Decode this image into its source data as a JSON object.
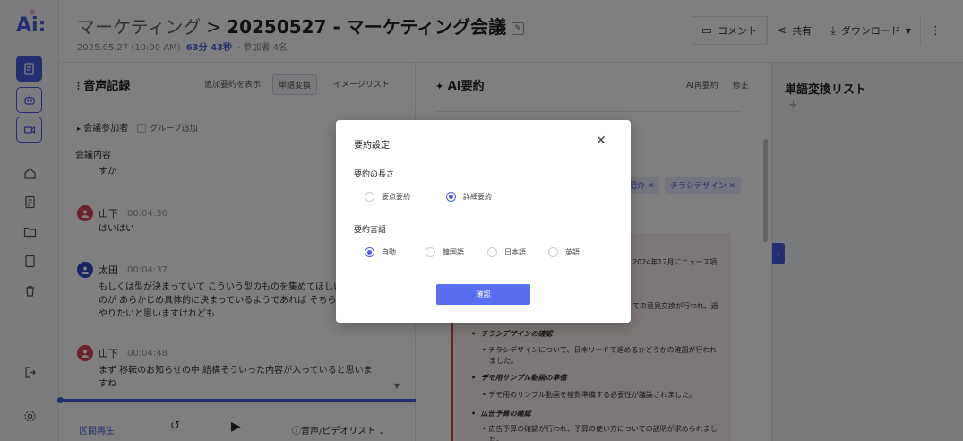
{
  "app": {
    "logo": "Ai:"
  },
  "header": {
    "parent": "マーケティング",
    "separator": ">",
    "title": "20250527 - マーケティング会議",
    "date": "2025.05.27 (10:00 AM)",
    "duration": "63分 43秒",
    "participants": "· 参加者 4名",
    "actions": {
      "comment": "コメント",
      "share": "共有",
      "download": "ダウンロード"
    }
  },
  "transcript": {
    "title": "音声記録",
    "tabs": [
      "追加要約を表示",
      "単語変換",
      "イメージリスト"
    ],
    "participants_label": "会議参加者",
    "group_add": "グループ追加",
    "content_label": "会議内容",
    "content_first": "すか",
    "entries": [
      {
        "speaker": "山下",
        "initial": "",
        "time": "00:04:36",
        "lines": [
          "はいはい"
        ]
      },
      {
        "speaker": "太田",
        "initial": "",
        "time": "00:04:37",
        "lines": [
          "もしくは型が決まっていて こういう型のものを集めてほしい",
          "のが あらかじめ具体的に決まっているようであれば そちら",
          "やりたいと思いますけれども"
        ]
      },
      {
        "speaker": "山下",
        "initial": "",
        "time": "00:04:48",
        "lines": [
          "まず 移転のお知らせの中 結構そういった内容が入っていると思いま",
          "すね"
        ]
      }
    ],
    "player": {
      "segment": "区間再生",
      "media": "音声/ビデオリスト"
    }
  },
  "summary": {
    "title": "AI要約",
    "actions": [
      "AI再要約",
      "修正"
    ],
    "chips": [
      "紹介 ✕",
      "チラシデザイン ✕"
    ],
    "lines": [
      {
        "text": "2024年12月にニュース項",
        "bold": false
      },
      {
        "text": "ての意見交換が行われ、過",
        "bold": false
      },
      {
        "text": "チラシデザインの確認",
        "bold": true
      },
      {
        "text": "• チラシデザインについて、日本リードで進めるかどうかの確認が行われ",
        "bold": false
      },
      {
        "text": "ました。",
        "bold": false
      },
      {
        "text": "デモ用サンプル動画の準備",
        "bold": true
      },
      {
        "text": "• デモ用のサンプル動画を複数準備する必要性が議論されました。",
        "bold": false
      },
      {
        "text": "広告予算の確認",
        "bold": true
      },
      {
        "text": "• 広告予算の確認が行われ、予算の使い方についての説明が求められまし",
        "bold": false
      },
      {
        "text": "た。",
        "bold": false
      }
    ]
  },
  "word_list": {
    "title": "単語変換リスト",
    "add": "+"
  },
  "modal": {
    "title": "要約設定",
    "close": "✕",
    "length_label": "要約の長さ",
    "length_options": [
      {
        "label": "要点要約",
        "selected": false
      },
      {
        "label": "詳細要約",
        "selected": true
      }
    ],
    "language_label": "要約言語",
    "language_options": [
      {
        "label": "自動",
        "selected": true
      },
      {
        "label": "韓国語",
        "selected": false
      },
      {
        "label": "日本語",
        "selected": false
      },
      {
        "label": "英語",
        "selected": false
      }
    ],
    "confirm": "確認"
  },
  "colors": {
    "accent": "#4b5de0",
    "button": "#5a6ef2",
    "avatar_red": "#d6455a",
    "avatar_blue": "#2f46c4"
  }
}
